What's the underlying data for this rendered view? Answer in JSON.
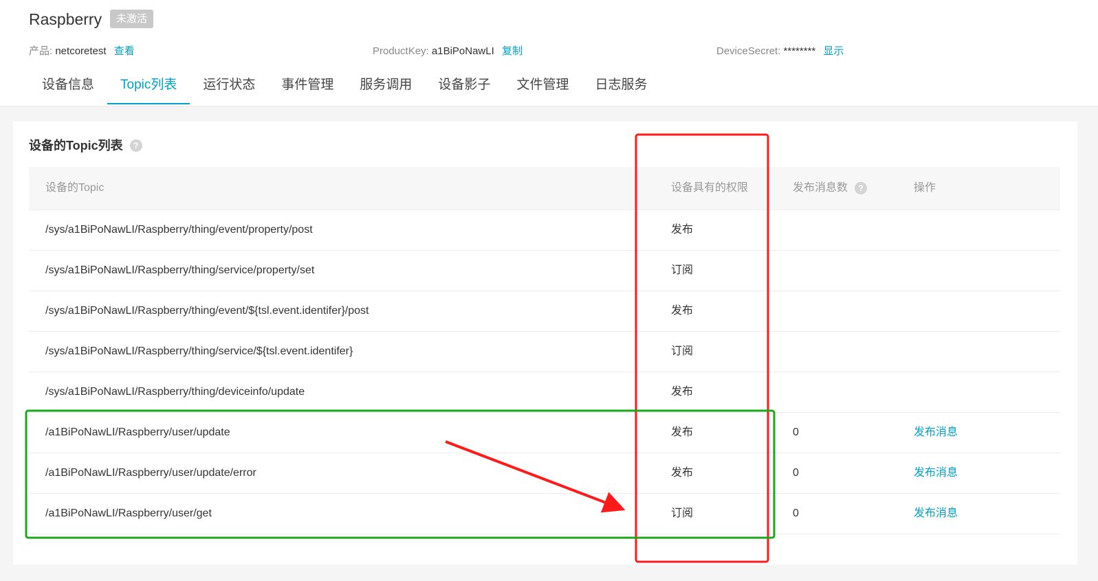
{
  "device": {
    "name": "Raspberry",
    "status": "未激活"
  },
  "meta": {
    "product_label": "产品:",
    "product_value": "netcoretest",
    "product_link": "查看",
    "productkey_label": "ProductKey:",
    "productkey_value": "a1BiPoNawLI",
    "productkey_link": "复制",
    "secret_label": "DeviceSecret:",
    "secret_value": "********",
    "secret_link": "显示"
  },
  "tabs": [
    {
      "label": "设备信息"
    },
    {
      "label": "Topic列表",
      "active": true
    },
    {
      "label": "运行状态"
    },
    {
      "label": "事件管理"
    },
    {
      "label": "服务调用"
    },
    {
      "label": "设备影子"
    },
    {
      "label": "文件管理"
    },
    {
      "label": "日志服务"
    }
  ],
  "panel": {
    "title": "设备的Topic列表",
    "help_glyph": "?"
  },
  "table": {
    "headers": {
      "topic": "设备的Topic",
      "permission": "设备具有的权限",
      "count": "发布消息数",
      "count_help": "?",
      "action": "操作"
    },
    "rows": [
      {
        "topic": "/sys/a1BiPoNawLI/Raspberry/thing/event/property/post",
        "permission": "发布",
        "count": "",
        "action": ""
      },
      {
        "topic": "/sys/a1BiPoNawLI/Raspberry/thing/service/property/set",
        "permission": "订阅",
        "count": "",
        "action": ""
      },
      {
        "topic": "/sys/a1BiPoNawLI/Raspberry/thing/event/${tsl.event.identifer}/post",
        "permission": "发布",
        "count": "",
        "action": ""
      },
      {
        "topic": "/sys/a1BiPoNawLI/Raspberry/thing/service/${tsl.event.identifer}",
        "permission": "订阅",
        "count": "",
        "action": ""
      },
      {
        "topic": "/sys/a1BiPoNawLI/Raspberry/thing/deviceinfo/update",
        "permission": "发布",
        "count": "",
        "action": ""
      },
      {
        "topic": "/a1BiPoNawLI/Raspberry/user/update",
        "permission": "发布",
        "count": "0",
        "action": "发布消息"
      },
      {
        "topic": "/a1BiPoNawLI/Raspberry/user/update/error",
        "permission": "发布",
        "count": "0",
        "action": "发布消息"
      },
      {
        "topic": "/a1BiPoNawLI/Raspberry/user/get",
        "permission": "订阅",
        "count": "0",
        "action": "发布消息"
      }
    ]
  },
  "colors": {
    "accent": "#00a2ca",
    "annotation_red": "#ff1a1a",
    "annotation_green": "#1aa81a"
  }
}
